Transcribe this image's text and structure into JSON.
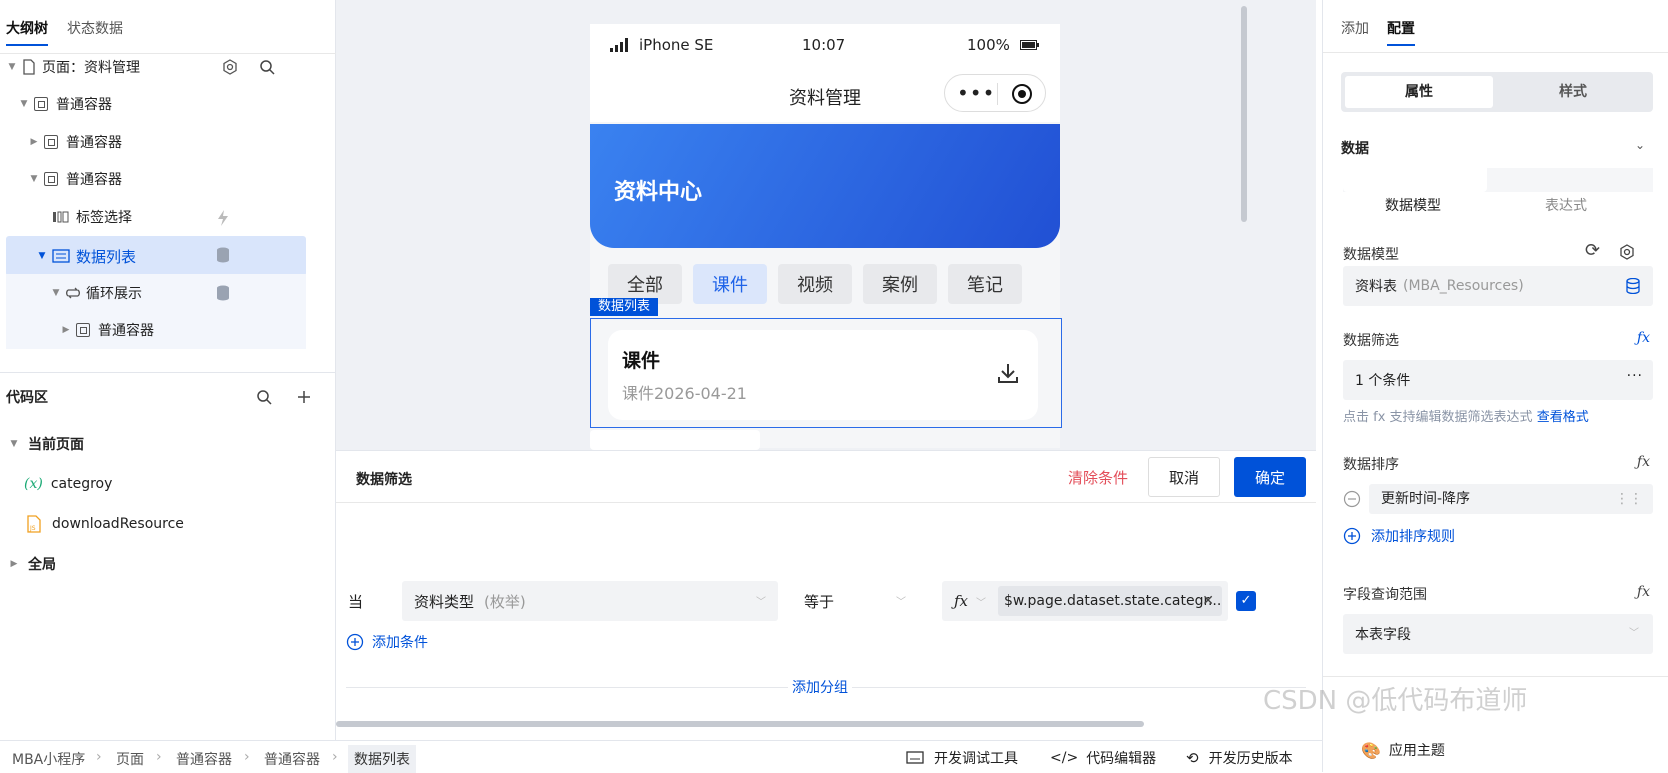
{
  "left": {
    "tabs": [
      "大纲树",
      "状态数据"
    ],
    "tree": [
      {
        "label": "页面：资料管理"
      },
      {
        "label": "普通容器"
      },
      {
        "label": "普通容器"
      },
      {
        "label": "普通容器"
      },
      {
        "label": "标签选择"
      },
      {
        "label": "数据列表"
      },
      {
        "label": "循环展示"
      },
      {
        "label": "普通容器"
      }
    ],
    "code": {
      "title": "代码区",
      "current_page": "当前页面",
      "items": [
        "categroy",
        "downloadResource"
      ],
      "global": "全局"
    }
  },
  "phone": {
    "device": "iPhone SE",
    "time": "10:07",
    "battery": "100%",
    "title": "资料管理",
    "banner_title": "资料中心",
    "chips": [
      "全部",
      "课件",
      "视频",
      "案例",
      "笔记"
    ],
    "selected_component_label": "数据列表",
    "card_title": "课件",
    "card_subtitle": "课件2026-04-21"
  },
  "dialog": {
    "title": "数据筛选",
    "clear": "清除条件",
    "cancel": "取消",
    "confirm": "确定",
    "when": "当",
    "field": "资料类型",
    "field_type": "(枚举)",
    "operator": "等于",
    "expression": "$w.page.dataset.state.categr...",
    "add_condition": "添加条件",
    "add_group": "添加分组"
  },
  "right": {
    "tabs": [
      "添加",
      "配置"
    ],
    "segments": [
      "属性",
      "样式"
    ],
    "data_section": "数据",
    "source_options": [
      "数据模型",
      "表达式"
    ],
    "model_label": "数据模型",
    "model_value": "资料表",
    "model_hint": "(MBA_Resources)",
    "filter_label": "数据筛选",
    "filter_value": "1 个条件",
    "filter_help": "点击 fx 支持编辑数据筛选表达式",
    "filter_help_link": "查看格式",
    "sort_label": "数据排序",
    "sort_value": "更新时间-降序",
    "add_sort": "添加排序规则",
    "fields_label": "字段查询范围",
    "fields_value": "本表字段",
    "theme": "应用主题",
    "watermark": "CSDN @低代码布道师"
  },
  "bottom": {
    "crumbs": [
      "MBA小程序",
      "页面",
      "普通容器",
      "普通容器",
      "数据列表"
    ],
    "tools": [
      "开发调试工具",
      "代码编辑器",
      "开发历史版本"
    ]
  },
  "colors": {
    "accent": "#0052d9",
    "danger": "#e34d59",
    "banner_start": "#3a82f0",
    "banner_end": "#2150d4"
  }
}
